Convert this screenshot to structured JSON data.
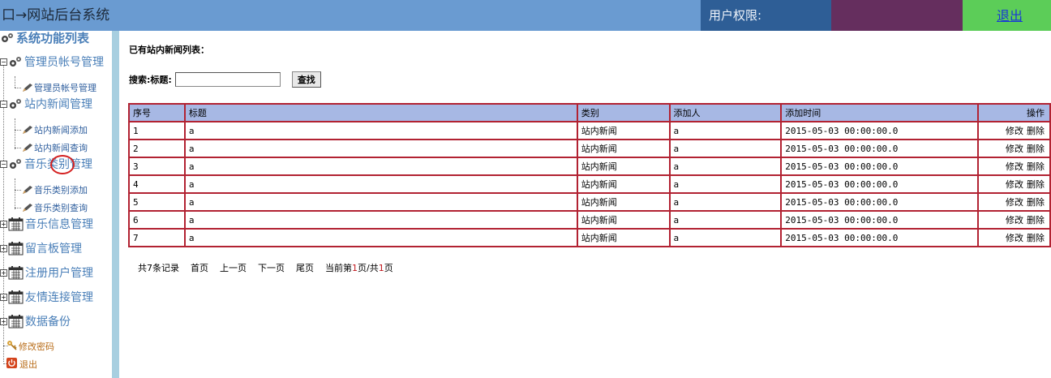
{
  "header": {
    "title": "口→网站后台系统",
    "permission_label": "用户权限:",
    "logout": "退出"
  },
  "sidebar": {
    "heading": "系统功能列表",
    "groups": [
      {
        "label": "管理员帐号管理",
        "icon": "gear-icon",
        "children": [
          "管理员帐号管理"
        ]
      },
      {
        "label": "站内新闻管理",
        "icon": "gear-icon",
        "children": [
          "站内新闻添加",
          "站内新闻查询"
        ]
      },
      {
        "label": "音乐类别管理",
        "icon": "gear-icon",
        "children": [
          "音乐类别添加",
          "音乐类别查询"
        ]
      },
      {
        "label": "音乐信息管理",
        "icon": "calendar-icon",
        "children": []
      },
      {
        "label": "留言板管理",
        "icon": "calendar-icon",
        "children": []
      },
      {
        "label": "注册用户管理",
        "icon": "calendar-icon",
        "children": []
      },
      {
        "label": "友情连接管理",
        "icon": "calendar-icon",
        "children": []
      },
      {
        "label": "数据备份",
        "icon": "calendar-icon",
        "children": []
      }
    ],
    "change_password": "修改密码",
    "logout": "退出"
  },
  "main": {
    "list_title": "已有站内新闻列表：",
    "search": {
      "label": "搜索:标题:",
      "value": "",
      "button": "查找"
    },
    "table": {
      "columns": [
        "序号",
        "标题",
        "类别",
        "添加人",
        "添加时间",
        "操作"
      ],
      "rows": [
        {
          "id": "1",
          "title": "a",
          "category": "站内新闻",
          "author": "a",
          "time": "2015-05-03 00:00:00.0"
        },
        {
          "id": "2",
          "title": "a",
          "category": "站内新闻",
          "author": "a",
          "time": "2015-05-03 00:00:00.0"
        },
        {
          "id": "3",
          "title": "a",
          "category": "站内新闻",
          "author": "a",
          "time": "2015-05-03 00:00:00.0"
        },
        {
          "id": "4",
          "title": "a",
          "category": "站内新闻",
          "author": "a",
          "time": "2015-05-03 00:00:00.0"
        },
        {
          "id": "5",
          "title": "a",
          "category": "站内新闻",
          "author": "a",
          "time": "2015-05-03 00:00:00.0"
        },
        {
          "id": "6",
          "title": "a",
          "category": "站内新闻",
          "author": "a",
          "time": "2015-05-03 00:00:00.0"
        },
        {
          "id": "7",
          "title": "a",
          "category": "站内新闻",
          "author": "a",
          "time": "2015-05-03 00:00:00.0"
        }
      ],
      "edit_label": "修改",
      "delete_label": "删除"
    },
    "pager": {
      "total_prefix": "共",
      "total": "7",
      "total_suffix": "条记录",
      "first": "首页",
      "prev": "上一页",
      "next": "下一页",
      "last": "尾页",
      "current_prefix": "当前第",
      "current": "1",
      "current_mid": "页/共",
      "pages": "1",
      "pages_suffix": "页"
    }
  },
  "colors": {
    "header_bg": "#6a9bd1",
    "permission_bg": "#2e5e96",
    "purple_block": "#652e5e",
    "green_block": "#5ccd58",
    "table_border": "#b22232",
    "table_header_bg": "#a7b8e4",
    "sidebar_link": "#4a7fb8"
  }
}
